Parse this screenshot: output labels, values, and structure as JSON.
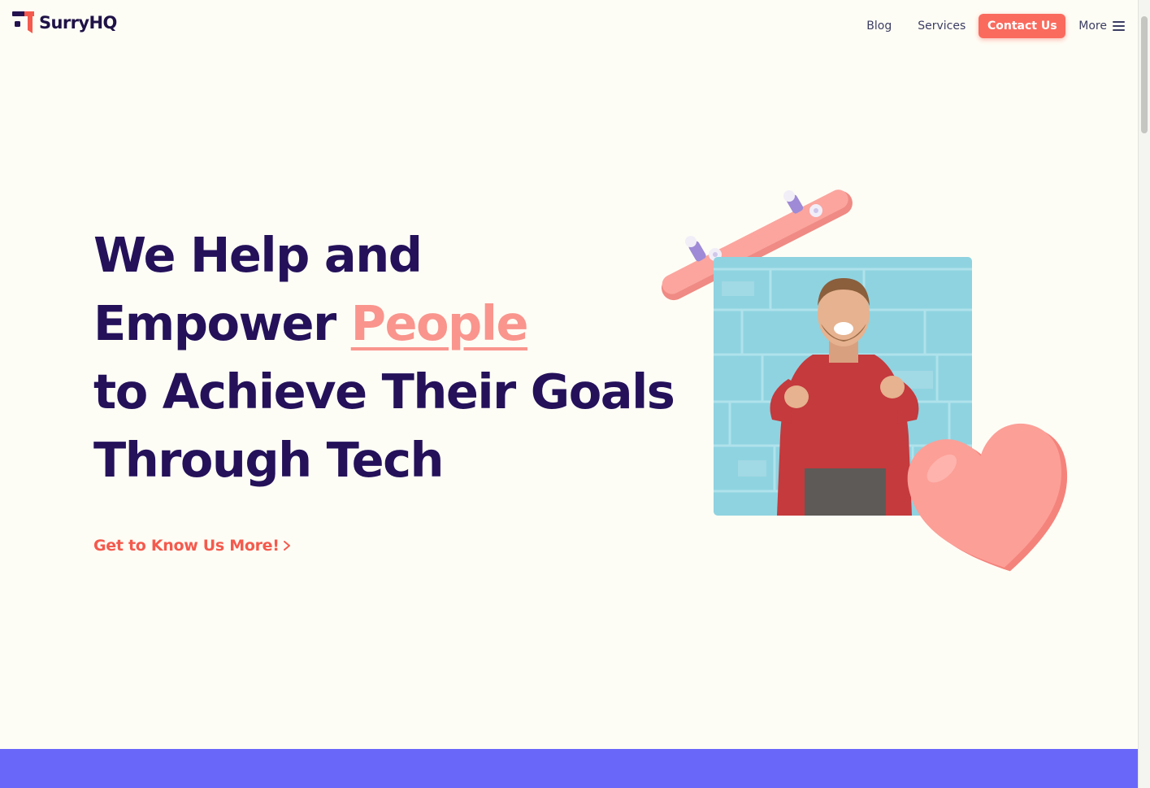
{
  "brand": {
    "name": "SurryHQ"
  },
  "nav": {
    "blog": "Blog",
    "services": "Services",
    "contact": "Contact Us",
    "more": "More"
  },
  "hero": {
    "line1": "We Help and",
    "line2_prefix": "Empower ",
    "line2_highlight": "People",
    "line3": "to Achieve Their Goals",
    "line4": "Through Tech",
    "cta": "Get to Know Us More!"
  },
  "colors": {
    "background": "#fefdf5",
    "headline": "#24115a",
    "accent": "#fa6b5e",
    "highlight": "#f9958d",
    "band": "#6967fa"
  },
  "icons": [
    "logo-mark-icon",
    "hamburger-menu-icon",
    "chevron-right-icon",
    "skateboard-illustration",
    "heart-illustration"
  ]
}
